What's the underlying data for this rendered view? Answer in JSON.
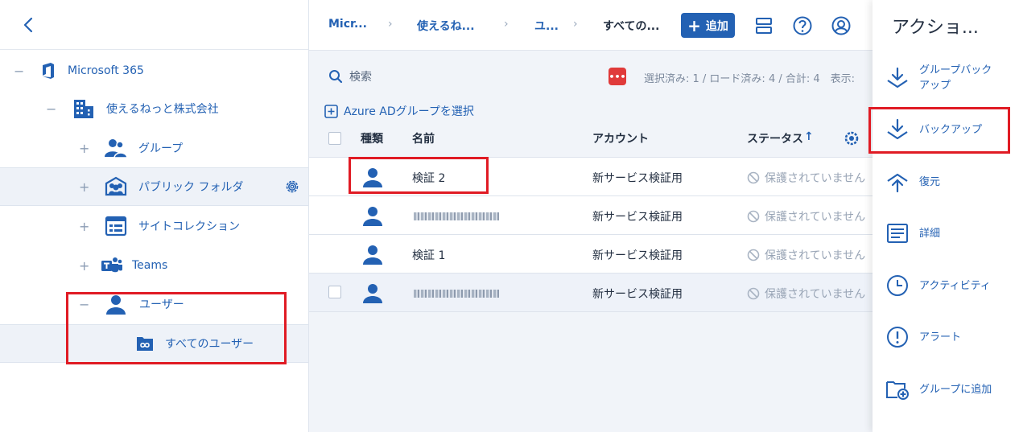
{
  "tree": {
    "items": [
      {
        "label": "Microsoft 365",
        "toggle": "−"
      },
      {
        "label": "使えるねっと株式会社",
        "toggle": "−"
      },
      {
        "label": "グループ",
        "toggle": "+"
      },
      {
        "label": "パブリック フォルダ",
        "toggle": "+"
      },
      {
        "label": "サイトコレクション",
        "toggle": "+"
      },
      {
        "label": "Teams",
        "toggle": "+"
      },
      {
        "label": "ユーザー",
        "toggle": "−"
      },
      {
        "label": "すべてのユーザー",
        "toggle": ""
      }
    ]
  },
  "breadcrumb": [
    "Micr...",
    "使えるね...",
    "ユ...",
    "すべての..."
  ],
  "toolbar": {
    "add_label": "追加"
  },
  "search": {
    "placeholder": "検索"
  },
  "status": {
    "badge": "•••",
    "text": "選択済み: 1 / ロード済み: 4 / 合計: 4　表示: "
  },
  "select_ad": "Azure ADグループを選択",
  "table": {
    "headers": {
      "type": "種類",
      "name": "名前",
      "account": "アカウント",
      "status": "ステータス"
    },
    "rows": [
      {
        "name": "検証 2",
        "account": "新サービス検証用",
        "status": "保護されていません"
      },
      {
        "name": "",
        "account": "新サービス検証用",
        "status": "保護されていません"
      },
      {
        "name": "検証 1",
        "account": "新サービス検証用",
        "status": "保護されていません"
      },
      {
        "name": "",
        "account": "新サービス検証用",
        "status": "保護されていません"
      }
    ]
  },
  "actions": {
    "title": "アクショ...",
    "items": [
      {
        "label": "グループバック\nアップ",
        "icon": "download-icon"
      },
      {
        "label": "バックアップ",
        "icon": "download-icon"
      },
      {
        "label": "復元",
        "icon": "restore-icon"
      },
      {
        "label": "詳細",
        "icon": "details-icon"
      },
      {
        "label": "アクティビティ",
        "icon": "clock-icon"
      },
      {
        "label": "アラート",
        "icon": "alert-icon"
      },
      {
        "label": "グループに追加",
        "icon": "folder-add-icon"
      }
    ]
  },
  "colors": {
    "accent": "#2361b3",
    "highlight": "#e01b24",
    "badge": "#e03a3a"
  }
}
